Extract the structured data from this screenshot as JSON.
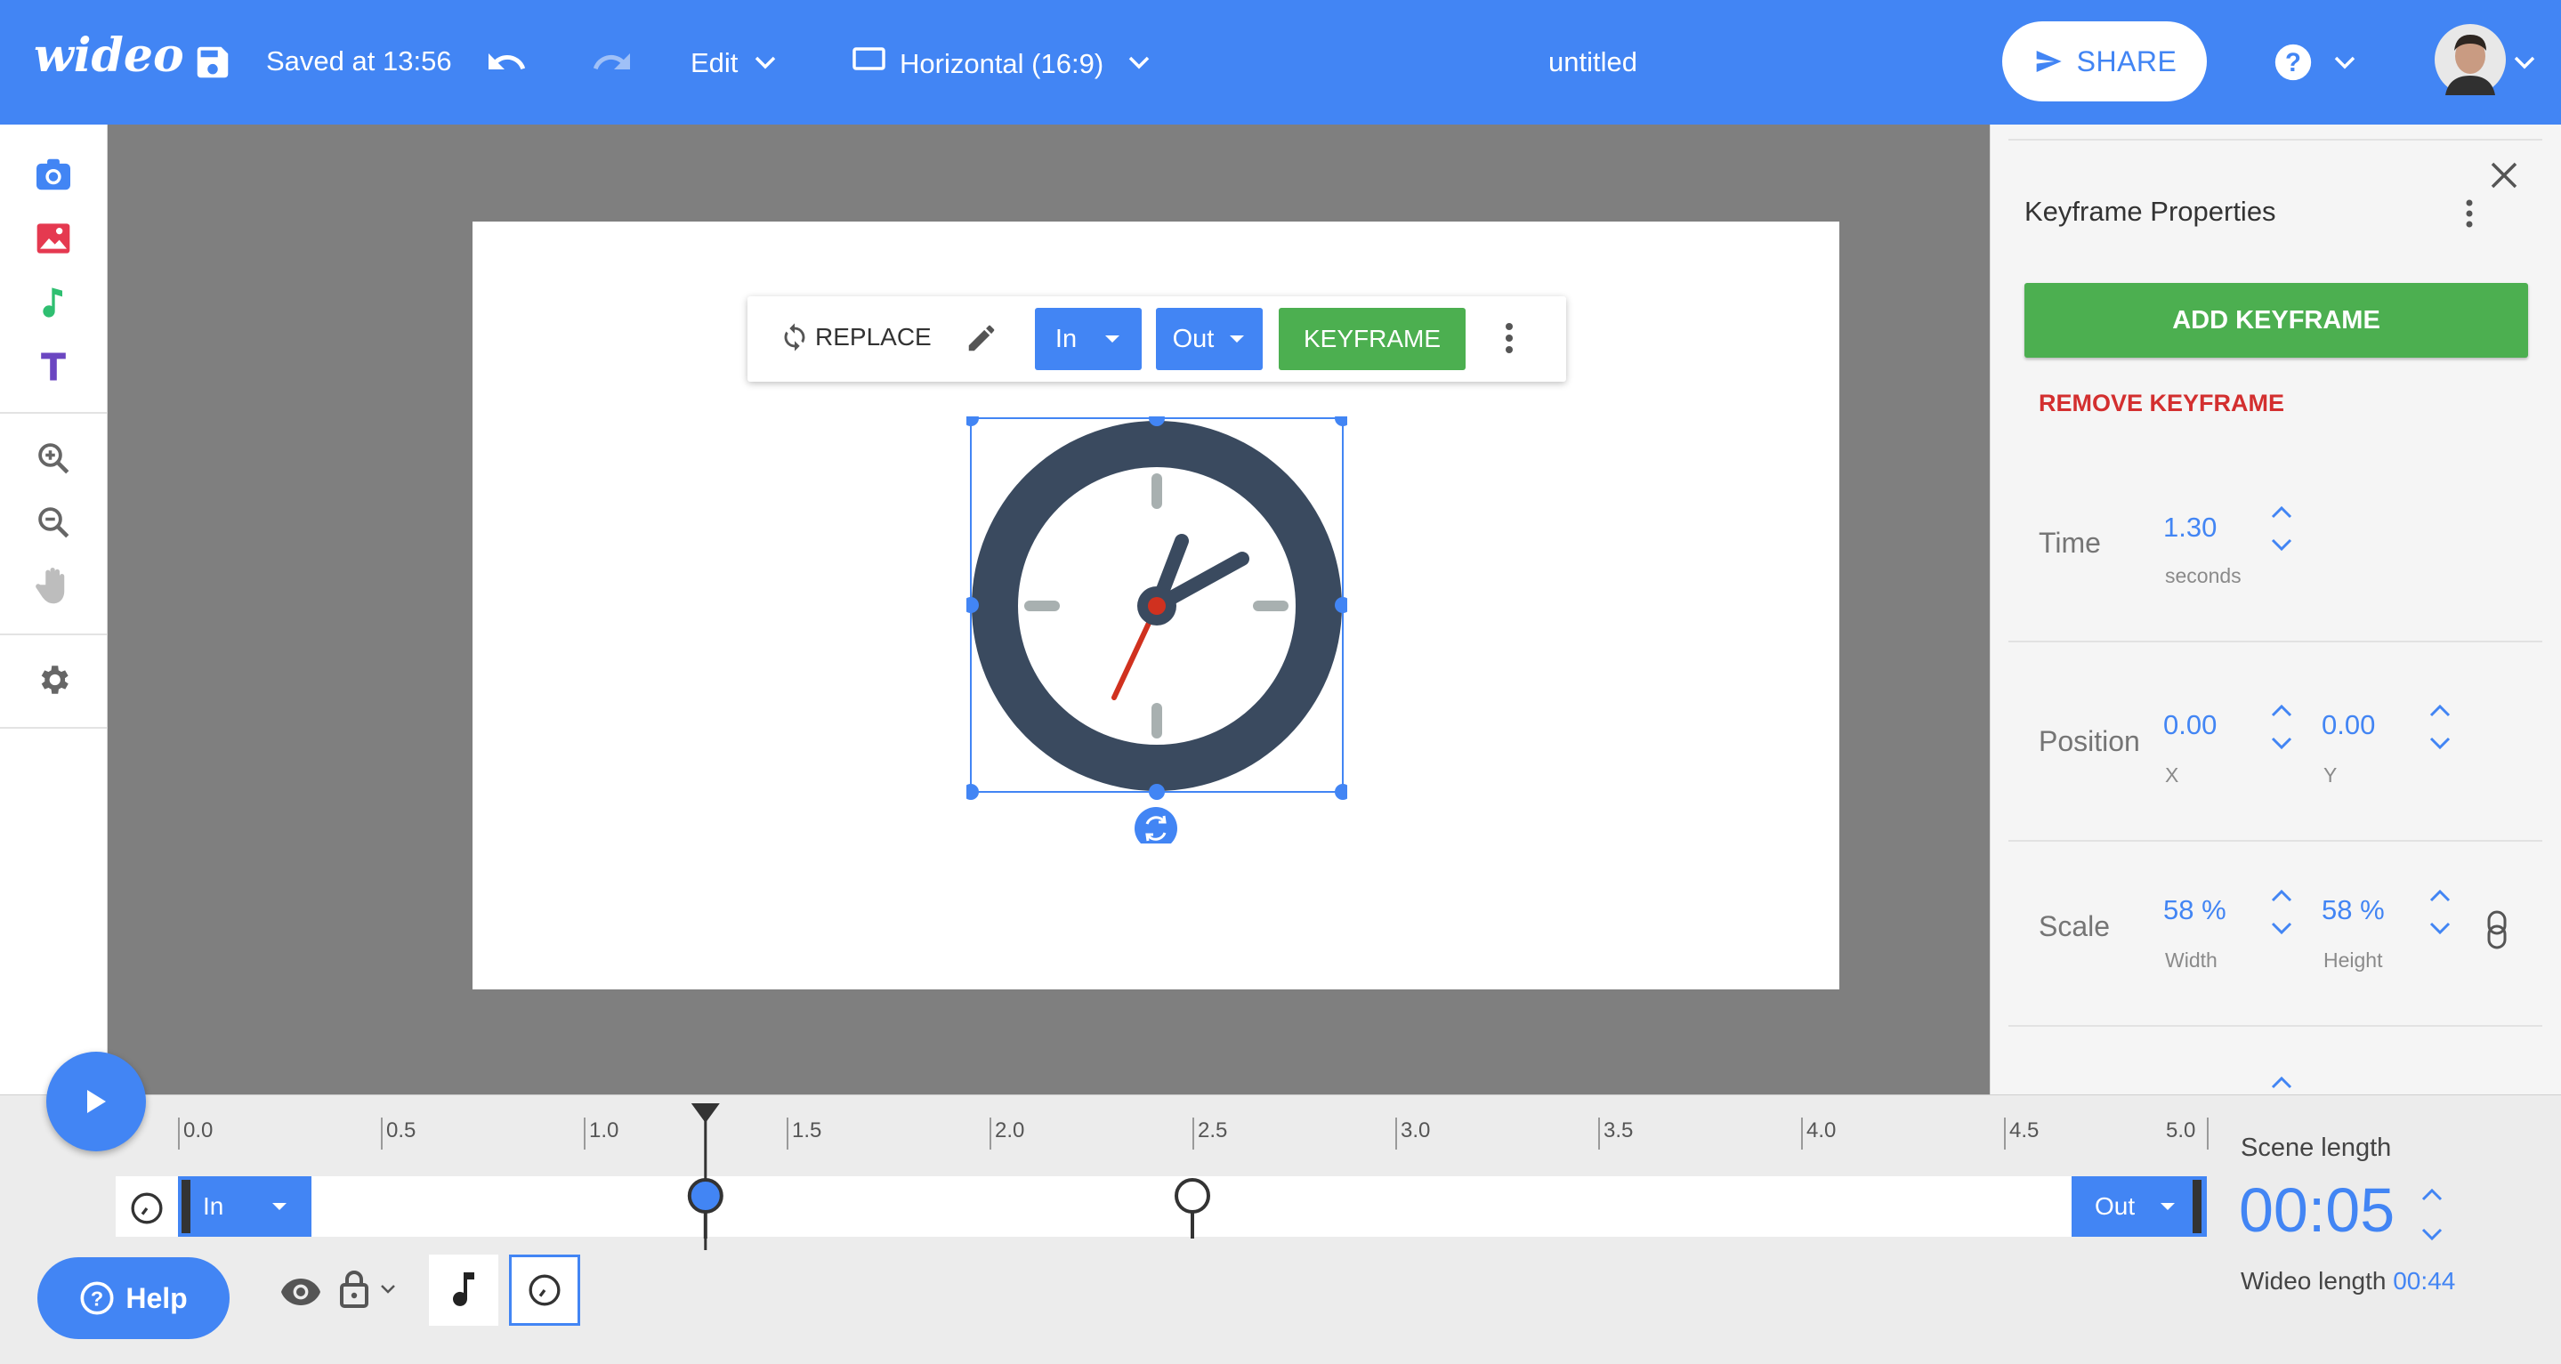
{
  "app": {
    "logo": "wideo",
    "title": "untitled"
  },
  "header": {
    "save_status": "Saved at 13:56",
    "edit_label": "Edit",
    "format_label": "Horizontal (16:9)",
    "share_label": "SHARE"
  },
  "left_toolbar": {
    "tools": [
      "camera-icon",
      "image-icon",
      "music-icon",
      "text-icon",
      "zoom-in-icon",
      "zoom-out-icon",
      "hand-icon",
      "gear-icon"
    ]
  },
  "element_toolbar": {
    "replace_label": "REPLACE",
    "in_label": "In",
    "out_label": "Out",
    "keyframe_label": "KEYFRAME"
  },
  "panel": {
    "title": "Keyframe Properties",
    "add_keyframe": "ADD KEYFRAME",
    "remove_keyframe": "REMOVE KEYFRAME",
    "time": {
      "label": "Time",
      "value": "1.30",
      "unit": "seconds"
    },
    "position": {
      "label": "Position",
      "x_value": "0.00",
      "x_label": "X",
      "y_value": "0.00",
      "y_label": "Y"
    },
    "scale": {
      "label": "Scale",
      "w_value": "58 %",
      "w_label": "Width",
      "h_value": "58 %",
      "h_label": "Height"
    }
  },
  "timeline": {
    "ticks": [
      "0.0",
      "0.5",
      "1.0",
      "1.5",
      "2.0",
      "2.5",
      "3.0",
      "3.5",
      "4.0",
      "4.5",
      "5.0"
    ],
    "in_label": "In",
    "out_label": "Out",
    "playhead_seconds": 1.3,
    "keyframes_seconds": [
      1.3,
      2.5
    ],
    "scene_length_label": "Scene length",
    "scene_length_value": "00:05",
    "wideo_length_label": "Wideo length",
    "wideo_length_value": "00:44",
    "help_label": "Help"
  },
  "colors": {
    "brand_blue": "#4285f4",
    "keyframe_green": "#4caf50",
    "remove_red": "#d32f2f",
    "clock_dark": "#3a4a5f"
  }
}
